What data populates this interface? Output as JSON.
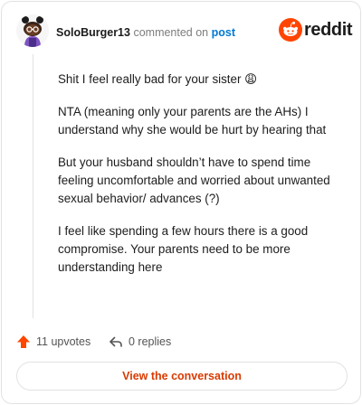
{
  "header": {
    "username": "SoloBurger13",
    "action_text": "commented on",
    "post_link": "post",
    "brand": "reddit"
  },
  "comment": {
    "paragraphs": [
      "Shit I feel really bad for your sister 😩",
      "NTA (meaning only your parents are the AHs) I understand why she would be hurt by hearing that",
      "But your husband shouldn’t have to spend time feeling uncomfortable and worried about unwanted sexual behavior/ advances (?)",
      "I feel like spending a few hours there is a good compromise. Your parents need to be more understanding here"
    ]
  },
  "footer": {
    "upvotes": "11 upvotes",
    "replies": "0 replies"
  },
  "button": {
    "label": "View the conversation"
  },
  "colors": {
    "brand": "#ff4500",
    "link": "#0079d3",
    "button_text": "#d93a00"
  },
  "icons": {
    "avatar": "snoo-avatar",
    "logo": "reddit-snoo-icon",
    "upvote": "upvote-arrow-icon",
    "reply": "reply-arrow-icon"
  }
}
